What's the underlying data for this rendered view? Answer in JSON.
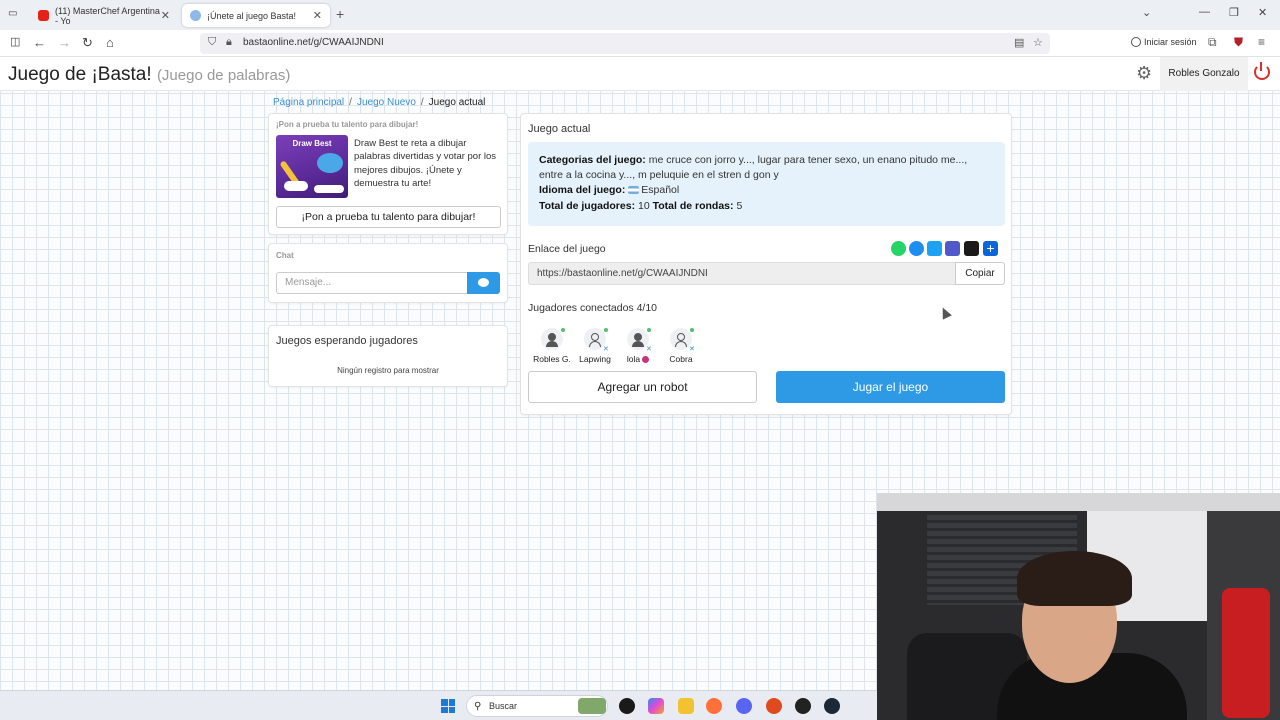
{
  "browser": {
    "tabs": [
      {
        "title": "(11) MasterChef Argentina - Yo",
        "active": false
      },
      {
        "title": "¡Únete al juego Basta!",
        "active": true
      }
    ],
    "url": "bastaonline.net/g/CWAAIJNDNI",
    "signin_label": "Iniciar sesión"
  },
  "header": {
    "title": "Juego de ¡Basta!",
    "subtitle": "(Juego de palabras)",
    "user_name": "Robles Gonzalo"
  },
  "breadcrumb": {
    "home": "Página principal",
    "new_game": "Juego Nuevo",
    "current": "Juego actual"
  },
  "ad": {
    "heading": "¡Pon a prueba tu talento para dibujar!",
    "image_title": "Draw Best",
    "text": "Draw Best te reta a dibujar palabras divertidas y votar por los mejores dibujos. ¡Únete y demuestra tu arte!",
    "button": "¡Pon a prueba tu talento para dibujar!"
  },
  "chat": {
    "heading": "Chat",
    "placeholder": "Mensaje..."
  },
  "waiting": {
    "heading": "Juegos esperando jugadores",
    "empty": "Ningún registro para mostrar"
  },
  "game": {
    "heading": "Juego actual",
    "categories_label": "Categorias del juego:",
    "categories_value": "me cruce con jorro y..., lugar para tener sexo, un enano pitudo me..., entre a la cocina y..., m peluquie en el stren d gon y",
    "language_label": "Idioma del juego:",
    "language_value": "Español",
    "players_label": "Total de jugadores:",
    "players_value": "10",
    "rounds_label": "Total de rondas:",
    "rounds_value": "5",
    "link_heading": "Enlace del juego",
    "link_value": "https://bastaonline.net/g/CWAAIJNDNI",
    "copy_button": "Copiar",
    "players_heading": "Jugadores conectados 4/10",
    "players": [
      {
        "name": "Robles G.",
        "host": true
      },
      {
        "name": "Lapwing",
        "host": false
      },
      {
        "name": "lola",
        "host": false
      },
      {
        "name": "Cobra",
        "host": false
      }
    ],
    "add_robot_button": "Agregar un robot",
    "play_button": "Jugar el juego"
  },
  "share_icons": [
    {
      "name": "whatsapp",
      "color": "#25d366"
    },
    {
      "name": "messenger",
      "color": "#1f8ef1"
    },
    {
      "name": "twitter",
      "color": "#1da1f2"
    },
    {
      "name": "teams",
      "color": "#5059c9"
    },
    {
      "name": "snapchat",
      "color": "#1a1a1a"
    },
    {
      "name": "share-more",
      "color": "#0a66d8"
    }
  ],
  "taskbar": {
    "search_label": "Buscar"
  }
}
